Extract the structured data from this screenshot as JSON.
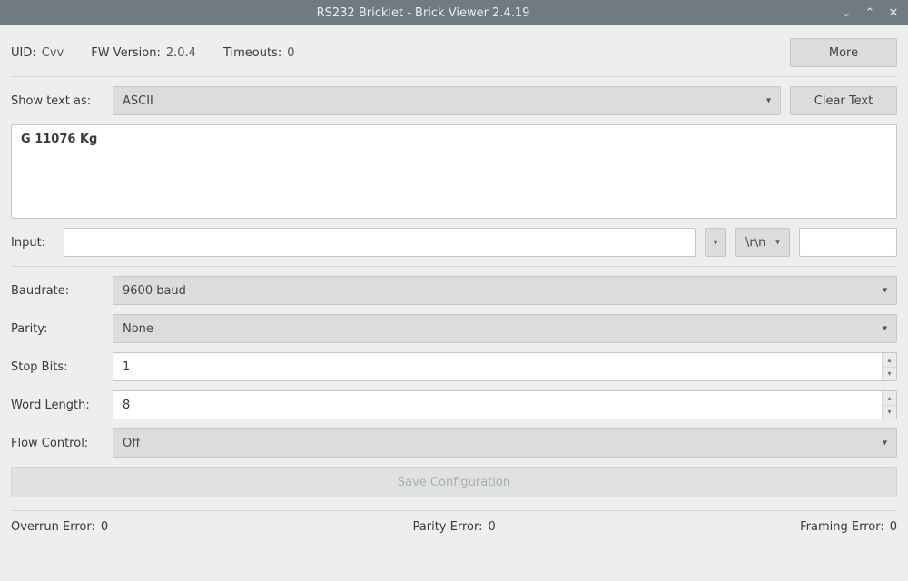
{
  "window": {
    "title": "RS232 Bricklet - Brick Viewer 2.4.19"
  },
  "header": {
    "uid_label": "UID:",
    "uid_value": "Cvv",
    "fw_label": "FW Version:",
    "fw_value": "2.0.4",
    "timeouts_label": "Timeouts:",
    "timeouts_value": "0",
    "more_label": "More"
  },
  "display": {
    "show_as_label": "Show text as:",
    "show_as_value": "ASCII",
    "clear_label": "Clear Text",
    "output_text": "G 11076    Kg"
  },
  "input": {
    "label": "Input:",
    "value": "",
    "line_ending": "\\r\\n"
  },
  "config": {
    "baudrate_label": "Baudrate:",
    "baudrate_value": "9600 baud",
    "parity_label": "Parity:",
    "parity_value": "None",
    "stopbits_label": "Stop Bits:",
    "stopbits_value": "1",
    "wordlen_label": "Word Length:",
    "wordlen_value": "8",
    "flow_label": "Flow Control:",
    "flow_value": "Off",
    "save_label": "Save Configuration"
  },
  "errors": {
    "overrun_label": "Overrun Error:",
    "overrun_value": "0",
    "parity_label": "Parity Error:",
    "parity_value": "0",
    "framing_label": "Framing Error:",
    "framing_value": "0"
  }
}
